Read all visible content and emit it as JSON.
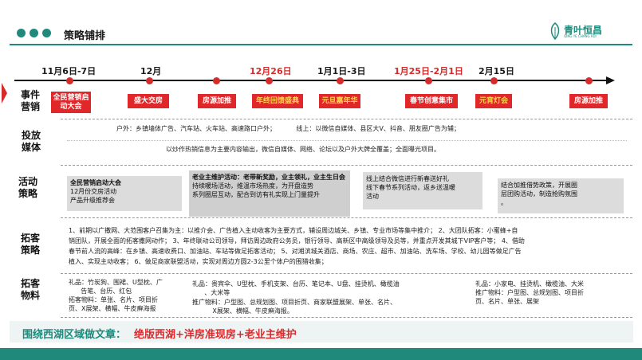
{
  "header": {
    "title": "策略铺排",
    "logo_cn": "青叶恒昌",
    "logo_en": "QING YE CHANG RUI"
  },
  "timeline": {
    "dates": [
      {
        "label": "11月6日-7日",
        "color": "dark"
      },
      {
        "label": "12月",
        "color": "dark"
      },
      {
        "label": "12月26日",
        "color": "red"
      },
      {
        "label": "1月1日-3日",
        "color": "dark"
      },
      {
        "label": "1月25日-2月1日",
        "color": "red"
      },
      {
        "label": "2月15日",
        "color": "dark"
      }
    ],
    "events": [
      {
        "label": "全民营销启动大会"
      },
      {
        "label": "盛大交房"
      },
      {
        "label": "房源加推"
      },
      {
        "label": "年终回馈盛典"
      },
      {
        "label": "元旦嘉年华"
      },
      {
        "label": "春节创意集市"
      },
      {
        "label": "元宵灯会"
      },
      {
        "label": "房源加推"
      }
    ]
  },
  "rows": {
    "event_marketing": "事件营销",
    "media": "投放媒体",
    "activity": "活动策略",
    "expansion": "拓客策略",
    "materials": "拓客物料"
  },
  "media": {
    "line1": "户外：乡镇墙体广告、汽车站、火车站、高速路口户外；          线上：以微信自媒体、县区大V、抖音、朋友圈广告为辅；",
    "line2": "以炒作热销信息为主要内容输出，微信自媒体、网络、论坛以及户外大牌全覆盖；全面曝光项目。"
  },
  "activity": {
    "box1_title": "全民营销启动大会",
    "box1_l1": "12月份交房活动",
    "box1_l2": "产品升级推荐会",
    "box2_title": "老业主维护活动：老带新奖励，业主领礼，业主生日会",
    "box2_l1": "持续暖场活动，维温市场热度，为开盘造势",
    "box2_l2": "系列圈层互动，配合到访有礼实现上门量提升",
    "box3_l1": "线上结合微信进行新春送好礼",
    "box3_l2": "线下春节系列活动，返乡送温暖",
    "box3_l3": "活动",
    "box4_l1": "结合加推借势政策，开展圈",
    "box4_l2": "层团购活动，制造抢购氛围",
    "box4_l3": "。"
  },
  "expansion": {
    "l1": "1、前期以广撒网、大范围客户召集为主：以推介会、广告植入主动收客为主要方式，辅设周边城关、乡镇、专业市场等集中推介；   2、大团队拓客：小蜜蜂+自",
    "l2": "销团队，开展全面的拓客撒网动作；   3、年终联动公司领导，拜访周边政府公务员，银行领导、高新区中高级领导及员等，并重点开发其城下VIP客户等；   4、借助",
    "l3": "春节前人流的高峰：在乡镇、高速收费口、加油站、车站等做足拓客活动；  5、对湘滨城关酒店、商场、农庄、超市、加油站、洗车场、学校、幼儿园等做足广告",
    "l4": "植入、实现主动收客；  6、做足商家联盟活动，实现对周边方圆2-3公里个体户的围猎收集；"
  },
  "materials": {
    "c1_l1": "礼品：竹炭狗、围裙、U型枕、广",
    "c1_l2": "      告笔、台历、红包",
    "c1_l3": "拓客物料：单张、名片、项目折",
    "c1_l4": "页、X展架、横幅、牛皮癣海报",
    "c2_l1": "礼品：贵宾伞、U型枕、手机支架、台历、笔记本、U盘、挂烫机、橄榄油",
    "c2_l2": "      、大米等",
    "c2_l3": "推广物料：户型图、总规划图、项目折页、商家联盟展架、单张、名片、",
    "c2_l4": "          X展架、横幅、牛皮癣海报。",
    "c3_l1": "礼品：小家电、挂烫机、橄榄油、大米",
    "c3_l2": "推广物料：户型图、总规划图、项目折",
    "c3_l3": "页、名片、单张、展架"
  },
  "bottom": {
    "prefix": "围绕西湖区域做文章：",
    "highlight": "绝版西湖+洋房准现房+老业主维护"
  }
}
